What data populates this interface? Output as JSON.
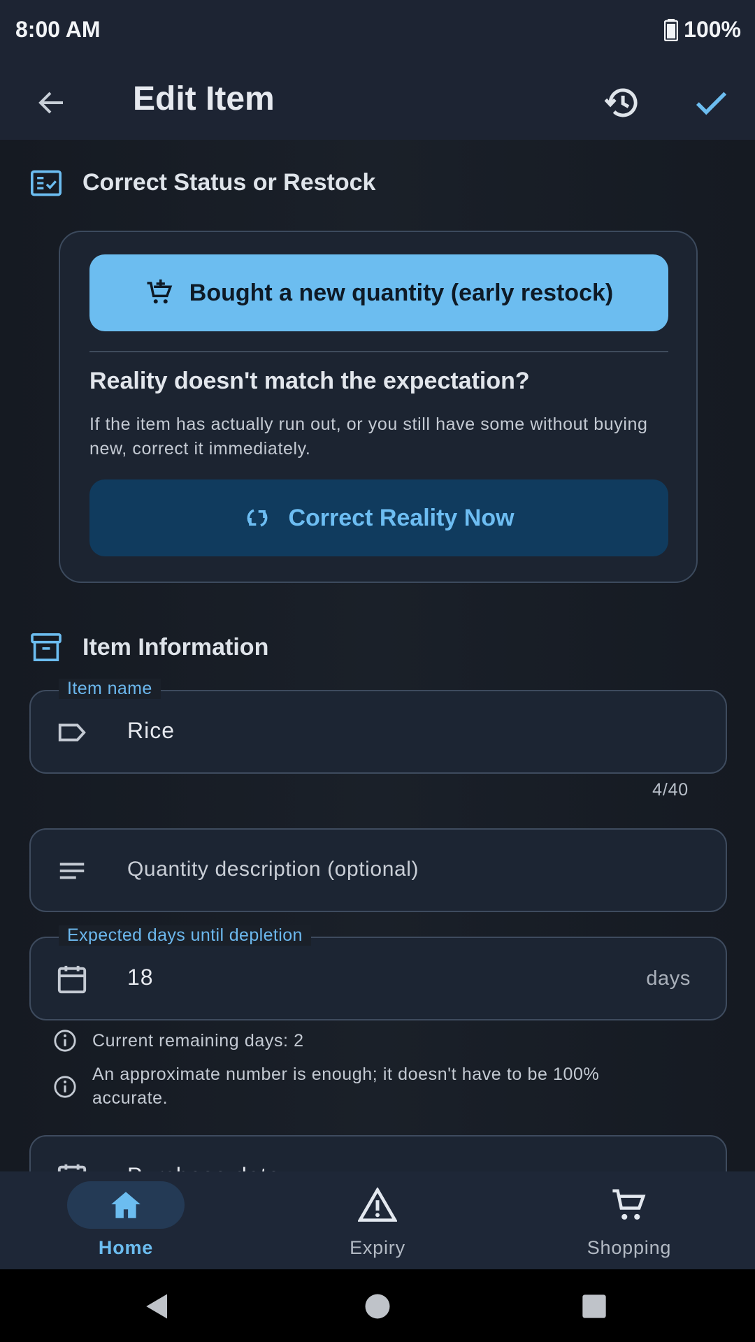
{
  "status_bar": {
    "time": "8:00 AM",
    "battery": "100%"
  },
  "app_bar": {
    "title": "Edit Item"
  },
  "restock_section": {
    "heading": "Correct Status or Restock",
    "bought_button": "Bought a new quantity (early restock)",
    "question": "Reality doesn't match the expectation?",
    "description": "If the item has actually run out, or you still have some without buying new, correct it immediately.",
    "correct_button": "Correct Reality Now"
  },
  "item_section": {
    "heading": "Item Information",
    "name_field": {
      "label": "Item name",
      "value": "Rice",
      "counter": "4/40"
    },
    "quantity_field": {
      "placeholder": "Quantity description (optional)"
    },
    "days_field": {
      "label": "Expected days until depletion",
      "value": "18",
      "suffix": "days"
    },
    "hints": [
      "Current remaining days: 2",
      "An approximate number is enough; it doesn't have to be 100% accurate."
    ],
    "next_field_partial": "Purchase date"
  },
  "bottom_nav": [
    {
      "label": "Home",
      "icon": "home-icon",
      "active": true
    },
    {
      "label": "Expiry",
      "icon": "warning-icon",
      "active": false
    },
    {
      "label": "Shopping",
      "icon": "cart-icon",
      "active": false
    }
  ],
  "colors": {
    "accent": "#6cbdf0",
    "background": "#161b24",
    "surface": "#1d2433"
  }
}
